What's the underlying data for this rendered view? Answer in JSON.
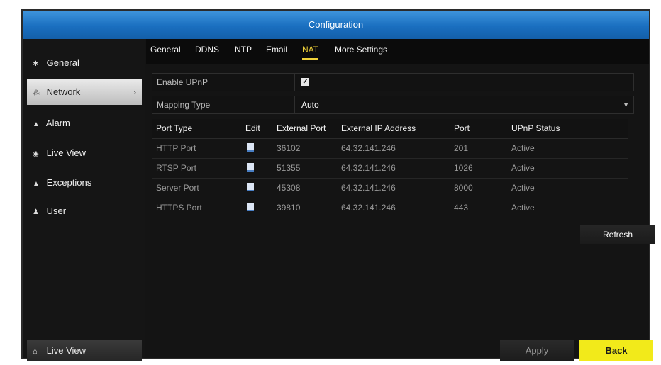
{
  "window": {
    "title": "Configuration"
  },
  "sidebar": {
    "items": [
      {
        "label": "General",
        "icon": "gear-icon"
      },
      {
        "label": "Network",
        "icon": "network-icon",
        "active": true
      },
      {
        "label": "Alarm",
        "icon": "alarm-icon"
      },
      {
        "label": "Live View",
        "icon": "eye-icon"
      },
      {
        "label": "Exceptions",
        "icon": "warning-icon"
      },
      {
        "label": "User",
        "icon": "users-icon"
      }
    ],
    "bottom": {
      "label": "Live View",
      "icon": "home-icon"
    }
  },
  "tabs": [
    {
      "label": "General"
    },
    {
      "label": "DDNS"
    },
    {
      "label": "NTP"
    },
    {
      "label": "Email"
    },
    {
      "label": "NAT",
      "active": true
    },
    {
      "label": "More Settings"
    }
  ],
  "form": {
    "enable_upnp": {
      "label": "Enable UPnP",
      "checked": true,
      "check_glyph": "✓"
    },
    "mapping_type": {
      "label": "Mapping Type",
      "value": "Auto"
    }
  },
  "table": {
    "headers": [
      "Port Type",
      "Edit",
      "External Port",
      "External IP Address",
      "Port",
      "UPnP Status"
    ],
    "rows": [
      {
        "port_type": "HTTP Port",
        "external_port": "36102",
        "external_ip": "64.32.141.246",
        "port": "201",
        "status": "Active"
      },
      {
        "port_type": "RTSP Port",
        "external_port": "51355",
        "external_ip": "64.32.141.246",
        "port": "1026",
        "status": "Active"
      },
      {
        "port_type": "Server Port",
        "external_port": "45308",
        "external_ip": "64.32.141.246",
        "port": "8000",
        "status": "Active"
      },
      {
        "port_type": "HTTPS Port",
        "external_port": "39810",
        "external_ip": "64.32.141.246",
        "port": "443",
        "status": "Active"
      }
    ]
  },
  "buttons": {
    "refresh": "Refresh",
    "apply": "Apply",
    "back": "Back"
  },
  "colors": {
    "title_bar": "#1a6fc0",
    "active_tab": "#f0d23a",
    "back_button": "#f2ea1a"
  }
}
